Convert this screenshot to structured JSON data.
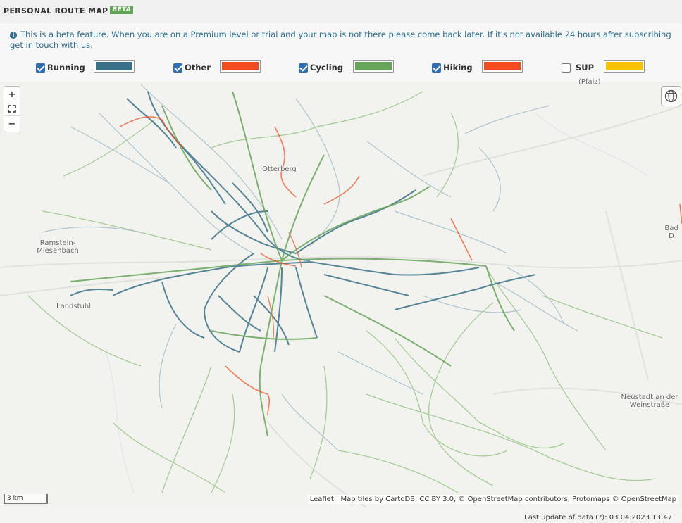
{
  "header": {
    "title": "PERSONAL ROUTE MAP",
    "badge": "BETA"
  },
  "info": {
    "icon": "info-icon",
    "text": "This is a beta feature. When you are on a Premium level or trial and your map is not there please come back later. If it's not available 24 hours after subscribing get in touch with us."
  },
  "legend": {
    "items": [
      {
        "label": "Running",
        "checked": true,
        "color": "#3b7188"
      },
      {
        "label": "Other",
        "checked": true,
        "color": "#f24b1e"
      },
      {
        "label": "Cycling",
        "checked": true,
        "color": "#67a55b"
      },
      {
        "label": "Hiking",
        "checked": true,
        "color": "#f24b1e"
      },
      {
        "label": "SUP",
        "checked": false,
        "color": "#f7c204"
      }
    ]
  },
  "map": {
    "zoom_in": "+",
    "fullscreen_icon": "fullscreen-icon",
    "zoom_out": "−",
    "layers_icon": "globe-icon",
    "places": [
      "Otterberg",
      "Ramstein-Miesenbach",
      "Landstuhl",
      "Neustadt an der Weinstraße",
      "Bad D",
      "(Pfalz)"
    ],
    "scale": "3 km",
    "attribution": "Leaflet | Map tiles by CartoDB, CC BY 3.0, © OpenStreetMap contributors, Protomaps © OpenStreetMap"
  },
  "footer": {
    "last_update": "Last update of data (?): 03.04.2023 13:47"
  }
}
